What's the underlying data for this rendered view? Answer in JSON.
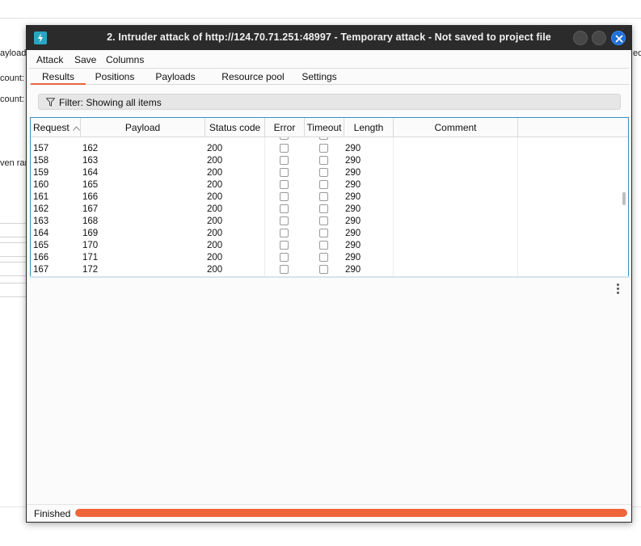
{
  "background": {
    "labels": [
      "ayload",
      "count:",
      "count:",
      "ven ran",
      "ed"
    ]
  },
  "window": {
    "title": "2. Intruder attack of http://124.70.71.251:48997 - Temporary attack - Not saved to project file",
    "app_icon": "burp-lightning-icon"
  },
  "menu": {
    "items": [
      "Attack",
      "Save",
      "Columns"
    ]
  },
  "tabs": {
    "items": [
      "Results",
      "Positions",
      "Payloads",
      "Resource pool",
      "Settings"
    ],
    "active": "Results"
  },
  "filter": {
    "label": "Filter: Showing all items"
  },
  "table": {
    "columns": [
      "Request",
      "Payload",
      "Status code",
      "Error",
      "Timeout",
      "Length",
      "Comment"
    ],
    "sort_column": "Request",
    "sort_direction": "ascending",
    "rows": [
      {
        "request": "157",
        "payload": "162",
        "status": "200",
        "error": false,
        "timeout": false,
        "length": "290",
        "comment": ""
      },
      {
        "request": "158",
        "payload": "163",
        "status": "200",
        "error": false,
        "timeout": false,
        "length": "290",
        "comment": ""
      },
      {
        "request": "159",
        "payload": "164",
        "status": "200",
        "error": false,
        "timeout": false,
        "length": "290",
        "comment": ""
      },
      {
        "request": "160",
        "payload": "165",
        "status": "200",
        "error": false,
        "timeout": false,
        "length": "290",
        "comment": ""
      },
      {
        "request": "161",
        "payload": "166",
        "status": "200",
        "error": false,
        "timeout": false,
        "length": "290",
        "comment": ""
      },
      {
        "request": "162",
        "payload": "167",
        "status": "200",
        "error": false,
        "timeout": false,
        "length": "290",
        "comment": ""
      },
      {
        "request": "163",
        "payload": "168",
        "status": "200",
        "error": false,
        "timeout": false,
        "length": "290",
        "comment": ""
      },
      {
        "request": "164",
        "payload": "169",
        "status": "200",
        "error": false,
        "timeout": false,
        "length": "290",
        "comment": ""
      },
      {
        "request": "165",
        "payload": "170",
        "status": "200",
        "error": false,
        "timeout": false,
        "length": "290",
        "comment": ""
      },
      {
        "request": "166",
        "payload": "171",
        "status": "200",
        "error": false,
        "timeout": false,
        "length": "290",
        "comment": ""
      },
      {
        "request": "167",
        "payload": "172",
        "status": "200",
        "error": false,
        "timeout": false,
        "length": "290",
        "comment": ""
      }
    ]
  },
  "status": {
    "text": "Finished",
    "progress": 1.0,
    "progress_color": "#f0643a"
  },
  "colors": {
    "titlebar": "#2b2b2b",
    "accent": "#e8643c",
    "close_button": "#1f6fd9",
    "app_icon": "#27a6c4"
  }
}
